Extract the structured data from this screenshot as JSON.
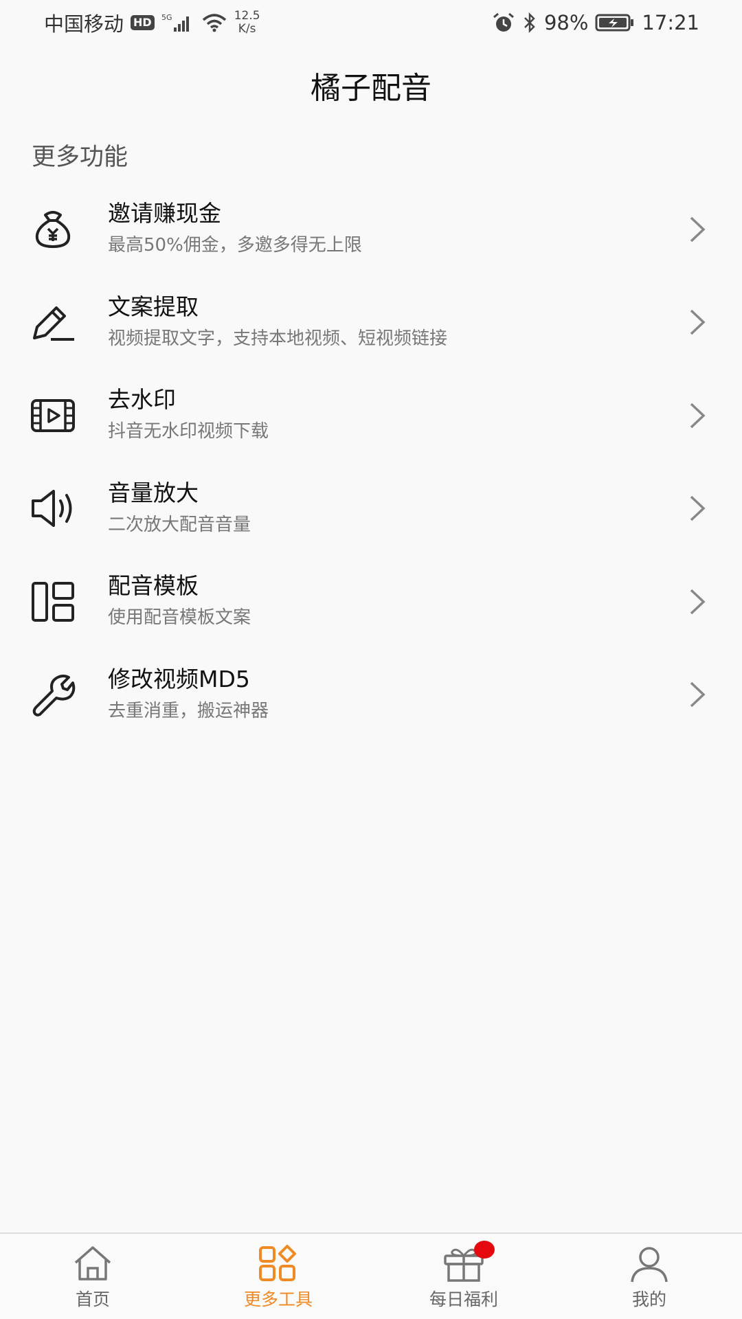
{
  "status_bar": {
    "carrier": "中国移动",
    "hd": "HD",
    "network": "5G",
    "speed_value": "12.5",
    "speed_unit": "K/s",
    "battery": "98%",
    "time": "17:21"
  },
  "header": {
    "title": "橘子配音"
  },
  "section": {
    "title": "更多功能"
  },
  "menu": [
    {
      "title": "邀请赚现金",
      "subtitle": "最高50%佣金，多邀多得无上限",
      "icon": "money-bag-icon"
    },
    {
      "title": "文案提取",
      "subtitle": "视频提取文字，支持本地视频、短视频链接",
      "icon": "pen-icon"
    },
    {
      "title": "去水印",
      "subtitle": "抖音无水印视频下载",
      "icon": "film-play-icon"
    },
    {
      "title": "音量放大",
      "subtitle": "二次放大配音音量",
      "icon": "speaker-icon"
    },
    {
      "title": "配音模板",
      "subtitle": "使用配音模板文案",
      "icon": "template-layout-icon"
    },
    {
      "title": "修改视频MD5",
      "subtitle": "去重消重，搬运神器",
      "icon": "wrench-icon"
    }
  ],
  "bottom_nav": [
    {
      "label": "首页",
      "icon": "home-icon",
      "active": false
    },
    {
      "label": "更多工具",
      "icon": "tools-grid-icon",
      "active": true
    },
    {
      "label": "每日福利",
      "icon": "gift-icon",
      "active": false
    },
    {
      "label": "我的",
      "icon": "user-icon",
      "active": false
    }
  ],
  "colors": {
    "accent": "#f08a24",
    "badge": "#e5090f",
    "text": "#111111",
    "subtext": "#777777"
  }
}
